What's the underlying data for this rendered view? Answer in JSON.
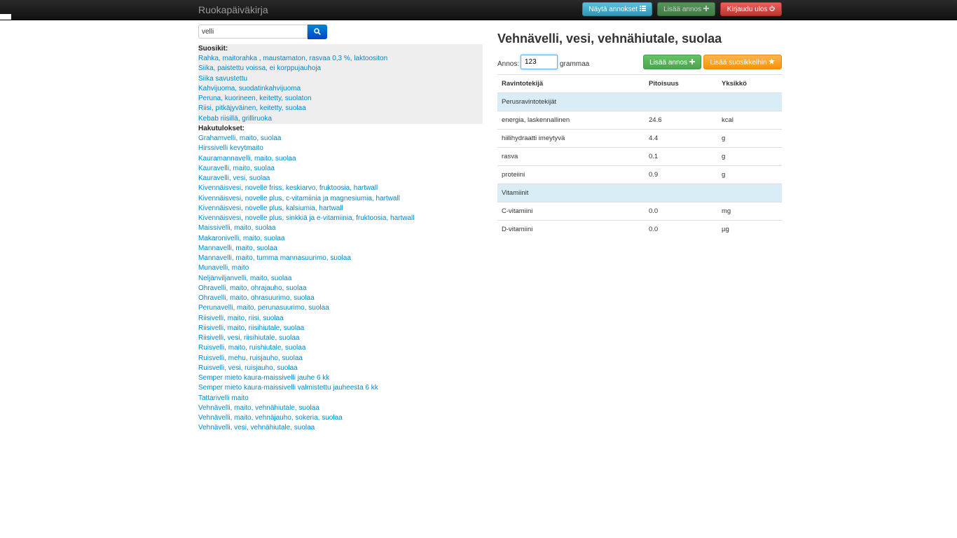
{
  "nav": {
    "brand": "Ruokapäiväkirja",
    "show_portions": "Näytä annokset",
    "add_portion": "Lisää annos",
    "logout": "Kirjaudu ulos"
  },
  "search": {
    "value": "velli"
  },
  "favorites": {
    "heading": "Suosikit:",
    "items": [
      "Rahka, maitorahka , maustamaton, rasvaa 0,3 %, laktoositon",
      "Siika, paistettu voissa, ei korppujauhoja",
      "Siika savustettu",
      "Kahvijuoma, suodatinkahvijuoma",
      "Peruna, kuorineen, keitetty, suolaton",
      "Riisi, pitkäjyväinen, keitetty, suolaa",
      "Kebab riisillä, grilliruoka"
    ]
  },
  "results": {
    "heading": "Hakutulokset:",
    "items": [
      "Grahamvelli, maito, suolaa",
      "Hirssivelli kevytmaito",
      "Kauramannavelli, maito, suolaa",
      "Kauravelli, maito, suolaa",
      "Kauravelli, vesi, suolaa",
      "Kivennäisvesi, novelle friss, keskiarvo, fruktoosia, hartwall",
      "Kivennäisvesi, novelle plus, c-vitamiinia ja magnesiumia, hartwall",
      "Kivennäisvesi, novelle plus, kalsiumia, hartwall",
      "Kivennäisvesi, novelle plus, sinkkiä ja e-vitamiinia, fruktoosia, hartwall",
      "Maissivelli, maito, suolaa",
      "Makaronivelli, maito, suolaa",
      "Mannavelli, maito, suolaa",
      "Mannavelli, maito, tumma mannasuurimo, suolaa",
      "Munavelli, maito",
      "Neljänviljanvelli, maito, suolaa",
      "Ohravelli, maito, ohrajauho, suolaa",
      "Ohravelli, maito, ohrasuurimo, suolaa",
      "Perunavelli, maito, perunasuurimo, suolaa",
      "Riisivelli, maito, riisi, suolaa",
      "Riisivelli, maito, riisihiutale, suolaa",
      "Riisivelli, vesi, riisihiutale, suolaa",
      "Ruisvelli, maito, ruishiutale, suolaa",
      "Ruisvelli, mehu, ruisjauho, suolaa",
      "Ruisvelli, vesi, ruisjauho, suolaa",
      "Semper mieto kaura-maissivelli jauhe 6 kk",
      "Semper mieto kaura-maissivelli valmistettu jauheesta 6 kk",
      "Tattarivelli maito",
      "Vehnävelli, maito, vehnähiutale, suolaa",
      "Vehnävelli, maito, vehnäjauho, sokeria, suolaa",
      "Vehnävelli, vesi, vehnähiutale, suolaa"
    ]
  },
  "detail": {
    "title": "Vehnävelli, vesi, vehnähiutale, suolaa",
    "portion_label": "Annos:",
    "portion_value": "123",
    "unit_label": "grammaa",
    "add_portion": "Lisää annos",
    "add_favorite": "Lisää suosikkeihin",
    "columns": [
      "Ravintotekijä",
      "Pitoisuus",
      "Yksikkö"
    ],
    "groups": [
      {
        "name": "Perusravintotekijät",
        "rows": [
          {
            "name": "energia, laskennallinen",
            "value": "24.6",
            "unit": "kcal"
          },
          {
            "name": "hiilihydraatti imeytyvä",
            "value": "4.4",
            "unit": "g"
          },
          {
            "name": "rasva",
            "value": "0.1",
            "unit": "g"
          },
          {
            "name": "proteiini",
            "value": "0.9",
            "unit": "g"
          }
        ]
      },
      {
        "name": "Vitamiinit",
        "rows": [
          {
            "name": "C-vitamiini",
            "value": "0.0",
            "unit": "mg"
          },
          {
            "name": "D-vitamiini",
            "value": "0.0",
            "unit": "µg"
          }
        ]
      }
    ]
  },
  "icons": {
    "list": "list-icon",
    "plus": "plus-icon",
    "power": "power-icon",
    "search": "search-icon",
    "star": "star-icon"
  },
  "colors": {
    "link": "#0088cc",
    "group_row": "#d9edf7",
    "fav_bg": "#eeeeee"
  }
}
